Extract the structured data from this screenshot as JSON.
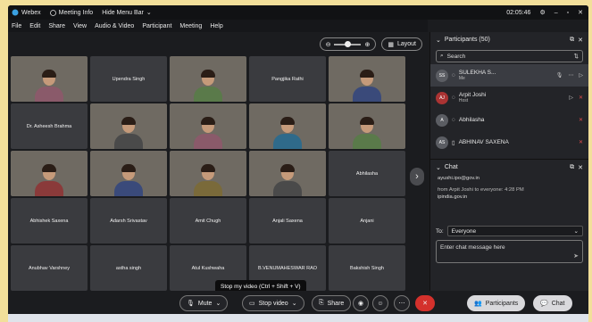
{
  "titlebar": {
    "app": "Webex",
    "meeting_info": "Meeting Info",
    "hide_menu": "Hide Menu Bar",
    "time": "02:05:46"
  },
  "menu": [
    "File",
    "Edit",
    "Share",
    "View",
    "Audio & Video",
    "Participant",
    "Meeting",
    "Help"
  ],
  "controls": {
    "layout_label": "Layout"
  },
  "tiles": [
    {
      "name": "",
      "video": true
    },
    {
      "name": "Upendra Singh",
      "video": false
    },
    {
      "name": "",
      "video": true
    },
    {
      "name": "Pangjika Rathi",
      "video": false
    },
    {
      "name": "",
      "video": true
    },
    {
      "name": "Dr. Asheesh Brahma",
      "video": false
    },
    {
      "name": "",
      "video": true
    },
    {
      "name": "",
      "video": true
    },
    {
      "name": "",
      "video": true
    },
    {
      "name": "",
      "video": true
    },
    {
      "name": "",
      "video": true
    },
    {
      "name": "",
      "video": true
    },
    {
      "name": "",
      "video": true
    },
    {
      "name": "",
      "video": true
    },
    {
      "name": "Abhilasha",
      "video": false
    },
    {
      "name": "Abhishek Saxena",
      "video": false
    },
    {
      "name": "Adarsh Srivastav",
      "video": false
    },
    {
      "name": "Amit Chugh",
      "video": false
    },
    {
      "name": "Anjali Saxena",
      "video": false
    },
    {
      "name": "Anjani",
      "video": false
    },
    {
      "name": "Anubhav Varshney",
      "video": false
    },
    {
      "name": "astha singh",
      "video": false
    },
    {
      "name": "Atul Kushwaha",
      "video": false
    },
    {
      "name": "B.VENUMAHESWAR RAO",
      "video": false
    },
    {
      "name": "Bakshish Singh",
      "video": false
    }
  ],
  "tooltip": "Stop my video (Ctrl + Shift + V)",
  "toolbar": {
    "mute": "Mute",
    "stop_video": "Stop video",
    "share": "Share",
    "participants": "Participants",
    "chat": "Chat"
  },
  "participants_panel": {
    "title": "Participants (50)",
    "search_placeholder": "Search",
    "rows": [
      {
        "initials": "SS",
        "name": "SULEKHA S...",
        "role": "Me"
      },
      {
        "initials": "AJ",
        "name": "Arpit Joshi",
        "role": "Host"
      },
      {
        "initials": "A",
        "name": "Abhilasha",
        "role": ""
      },
      {
        "initials": "AS",
        "name": "ABHINAV SAXENA",
        "role": ""
      }
    ]
  },
  "chat_panel": {
    "title": "Chat",
    "messages": [
      {
        "line1": "",
        "line2": "ayushi.ipo@gov.in"
      },
      {
        "line1": "from Arpit Joshi to everyone:   4:28 PM",
        "line2": "ipindia.gov.in"
      }
    ],
    "to_label": "To:",
    "to_value": "Everyone",
    "input_placeholder": "Enter chat message here"
  },
  "colors": {
    "background": "#1b1c1f",
    "end_call": "#d4312c",
    "frame": "#f2df9a"
  }
}
